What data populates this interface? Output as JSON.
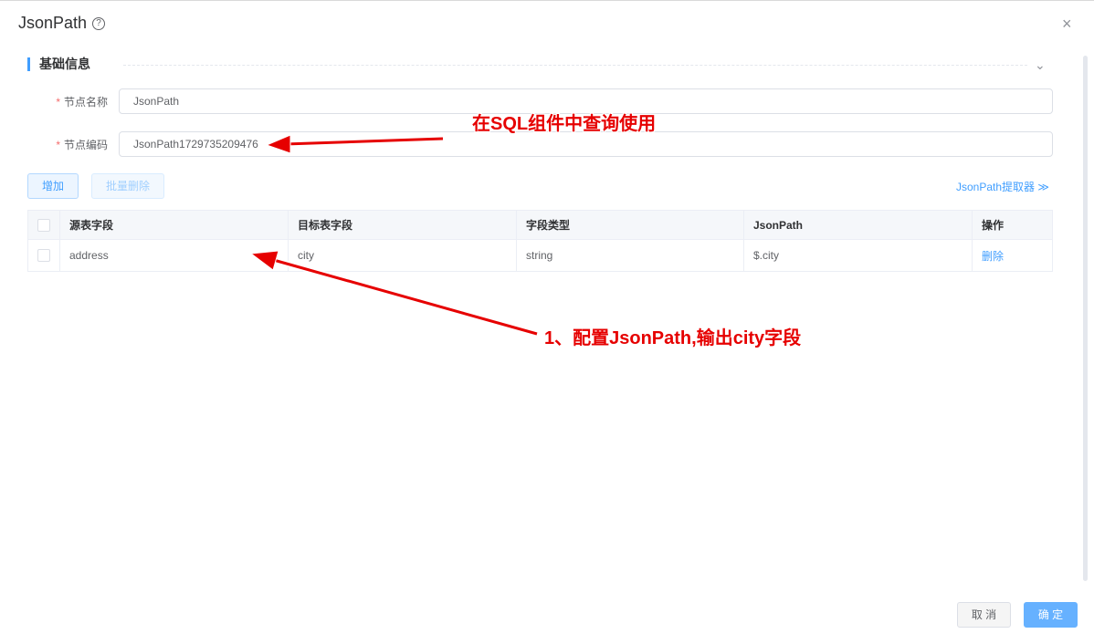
{
  "dialog": {
    "title": "JsonPath",
    "help_icon": "?",
    "close_icon": "×"
  },
  "section": {
    "title": "基础信息"
  },
  "form": {
    "name_label": "节点名称",
    "name_value": "JsonPath",
    "code_label": "节点编码",
    "code_value": "JsonPath1729735209476",
    "required_mark": "*"
  },
  "toolbar": {
    "add_label": "增加",
    "batch_delete_label": "批量删除",
    "extract_link": "JsonPath提取器 ≫"
  },
  "table": {
    "headers": [
      "源表字段",
      "目标表字段",
      "字段类型",
      "JsonPath",
      "操作"
    ],
    "rows": [
      {
        "source": "address",
        "target": "city",
        "type": "string",
        "jsonpath": "$.city",
        "action": "删除"
      }
    ]
  },
  "annotations": {
    "top": "在SQL组件中查询使用",
    "bottom": "1、配置JsonPath,输出city字段"
  },
  "footer": {
    "cancel_label": "取 消",
    "ok_label": "确 定"
  },
  "colors": {
    "accent": "#409eff",
    "annotation": "#e60000"
  }
}
